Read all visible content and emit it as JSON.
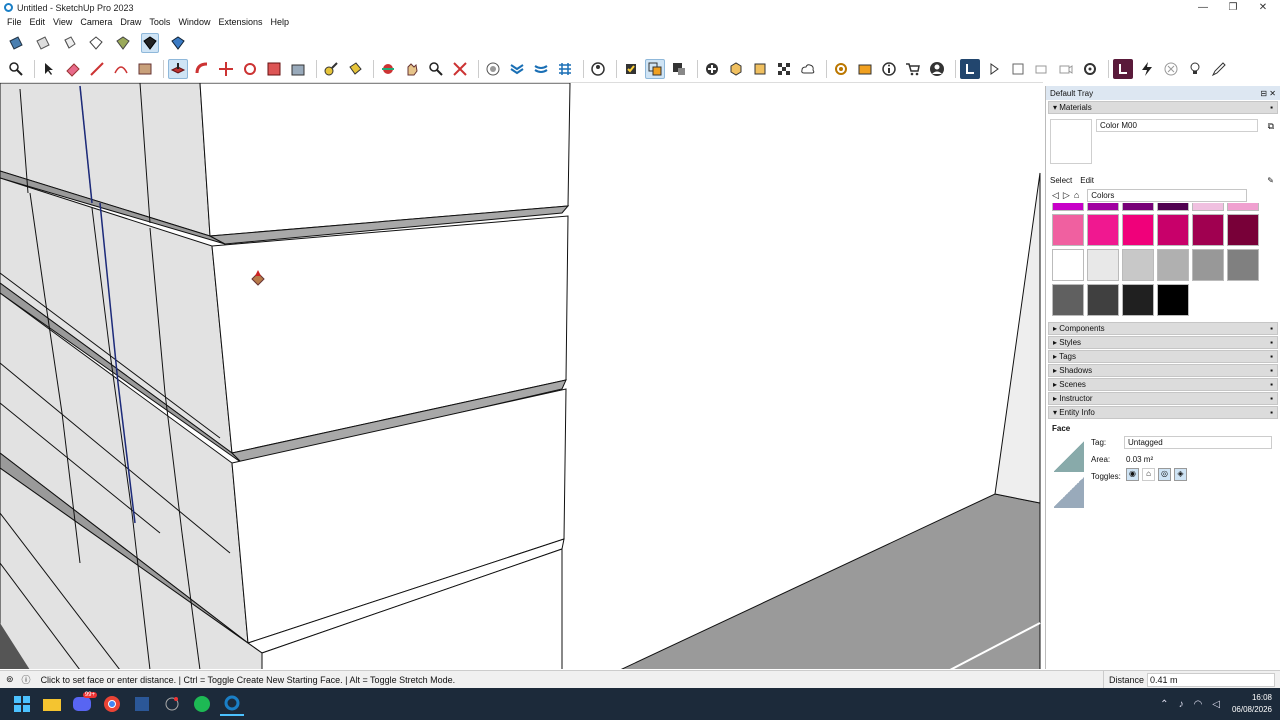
{
  "window": {
    "title": "Untitled - SketchUp Pro 2023",
    "minimize": "—",
    "maximize": "❐",
    "close": "✕"
  },
  "menu": [
    "File",
    "Edit",
    "View",
    "Camera",
    "Draw",
    "Tools",
    "Window",
    "Extensions",
    "Help"
  ],
  "tray": {
    "title": "Default Tray",
    "materials": {
      "header": "Materials",
      "name": "Color M00",
      "tab_select": "Select",
      "tab_edit": "Edit",
      "library": "Colors",
      "swatch_colors": [
        [
          "#c800c8",
          "#a000a0",
          "#780078",
          "#500050",
          "#f0c0e0",
          "#f0a0d0"
        ],
        [
          "#f060a0",
          "#f01890",
          "#f0007a",
          "#c8006a",
          "#a00050",
          "#780038"
        ],
        [
          "#ffffff",
          "#e8e8e8",
          "#c8c8c8",
          "#b0b0b0",
          "#989898",
          "#808080"
        ],
        [
          "#606060",
          "#404040",
          "#202020",
          "#000000"
        ]
      ]
    },
    "panels": [
      "Components",
      "Styles",
      "Tags",
      "Shadows",
      "Scenes",
      "Instructor",
      "Entity Info"
    ],
    "entity": {
      "type": "Face",
      "tag_label": "Tag:",
      "tag_value": "Untagged",
      "area_label": "Area:",
      "area_value": "0.03 m²",
      "toggles_label": "Toggles:"
    }
  },
  "status": {
    "hint": "Click to set face or enter distance. | Ctrl = Toggle Create New Starting Face. | Alt = Toggle Stretch Mode.",
    "measure_label": "Distance",
    "measure_value": "0.41 m"
  },
  "clock": {
    "time": "16:08",
    "date": "06/08/2026"
  },
  "taskbar": {
    "discord_badge": "99+"
  },
  "icons": {
    "toolbar1": [
      "section-plane-icon",
      "section-fill-icon",
      "section-lines-icon",
      "display-section-icon",
      "component-icon",
      "shadow-icon",
      "warehouse-icon"
    ],
    "toolbar2": [
      "zoom-icon",
      "select-icon",
      "eraser-icon",
      "line-icon",
      "arc-icon",
      "rectangle-icon",
      "push-pull-icon",
      "follow-me-icon",
      "move-icon",
      "rotate-icon",
      "scale-icon",
      "offset-icon",
      "tape-measure-icon",
      "paint-bucket-icon",
      "orbit-icon",
      "pan-icon",
      "zoom-window-icon",
      "zoom-extents-icon",
      "3d-warehouse-icon",
      "extension-warehouse-icon",
      "layout-icon",
      "account-icon",
      "solid-tools-icon",
      "outer-shell-icon",
      "intersect-icon",
      "add-icon",
      "sandbox-icon",
      "stamp-icon",
      "drape-icon",
      "flip-icon",
      "cloud-icon",
      "settings-icon",
      "folder-icon",
      "info-icon",
      "cart-icon",
      "user-icon",
      "profile-icon",
      "play-icon",
      "stop-icon",
      "camera-icon",
      "video-icon",
      "gear-icon",
      "brand-icon",
      "lightning-icon",
      "cancel-icon",
      "bulb-icon",
      "pencil-icon"
    ]
  }
}
